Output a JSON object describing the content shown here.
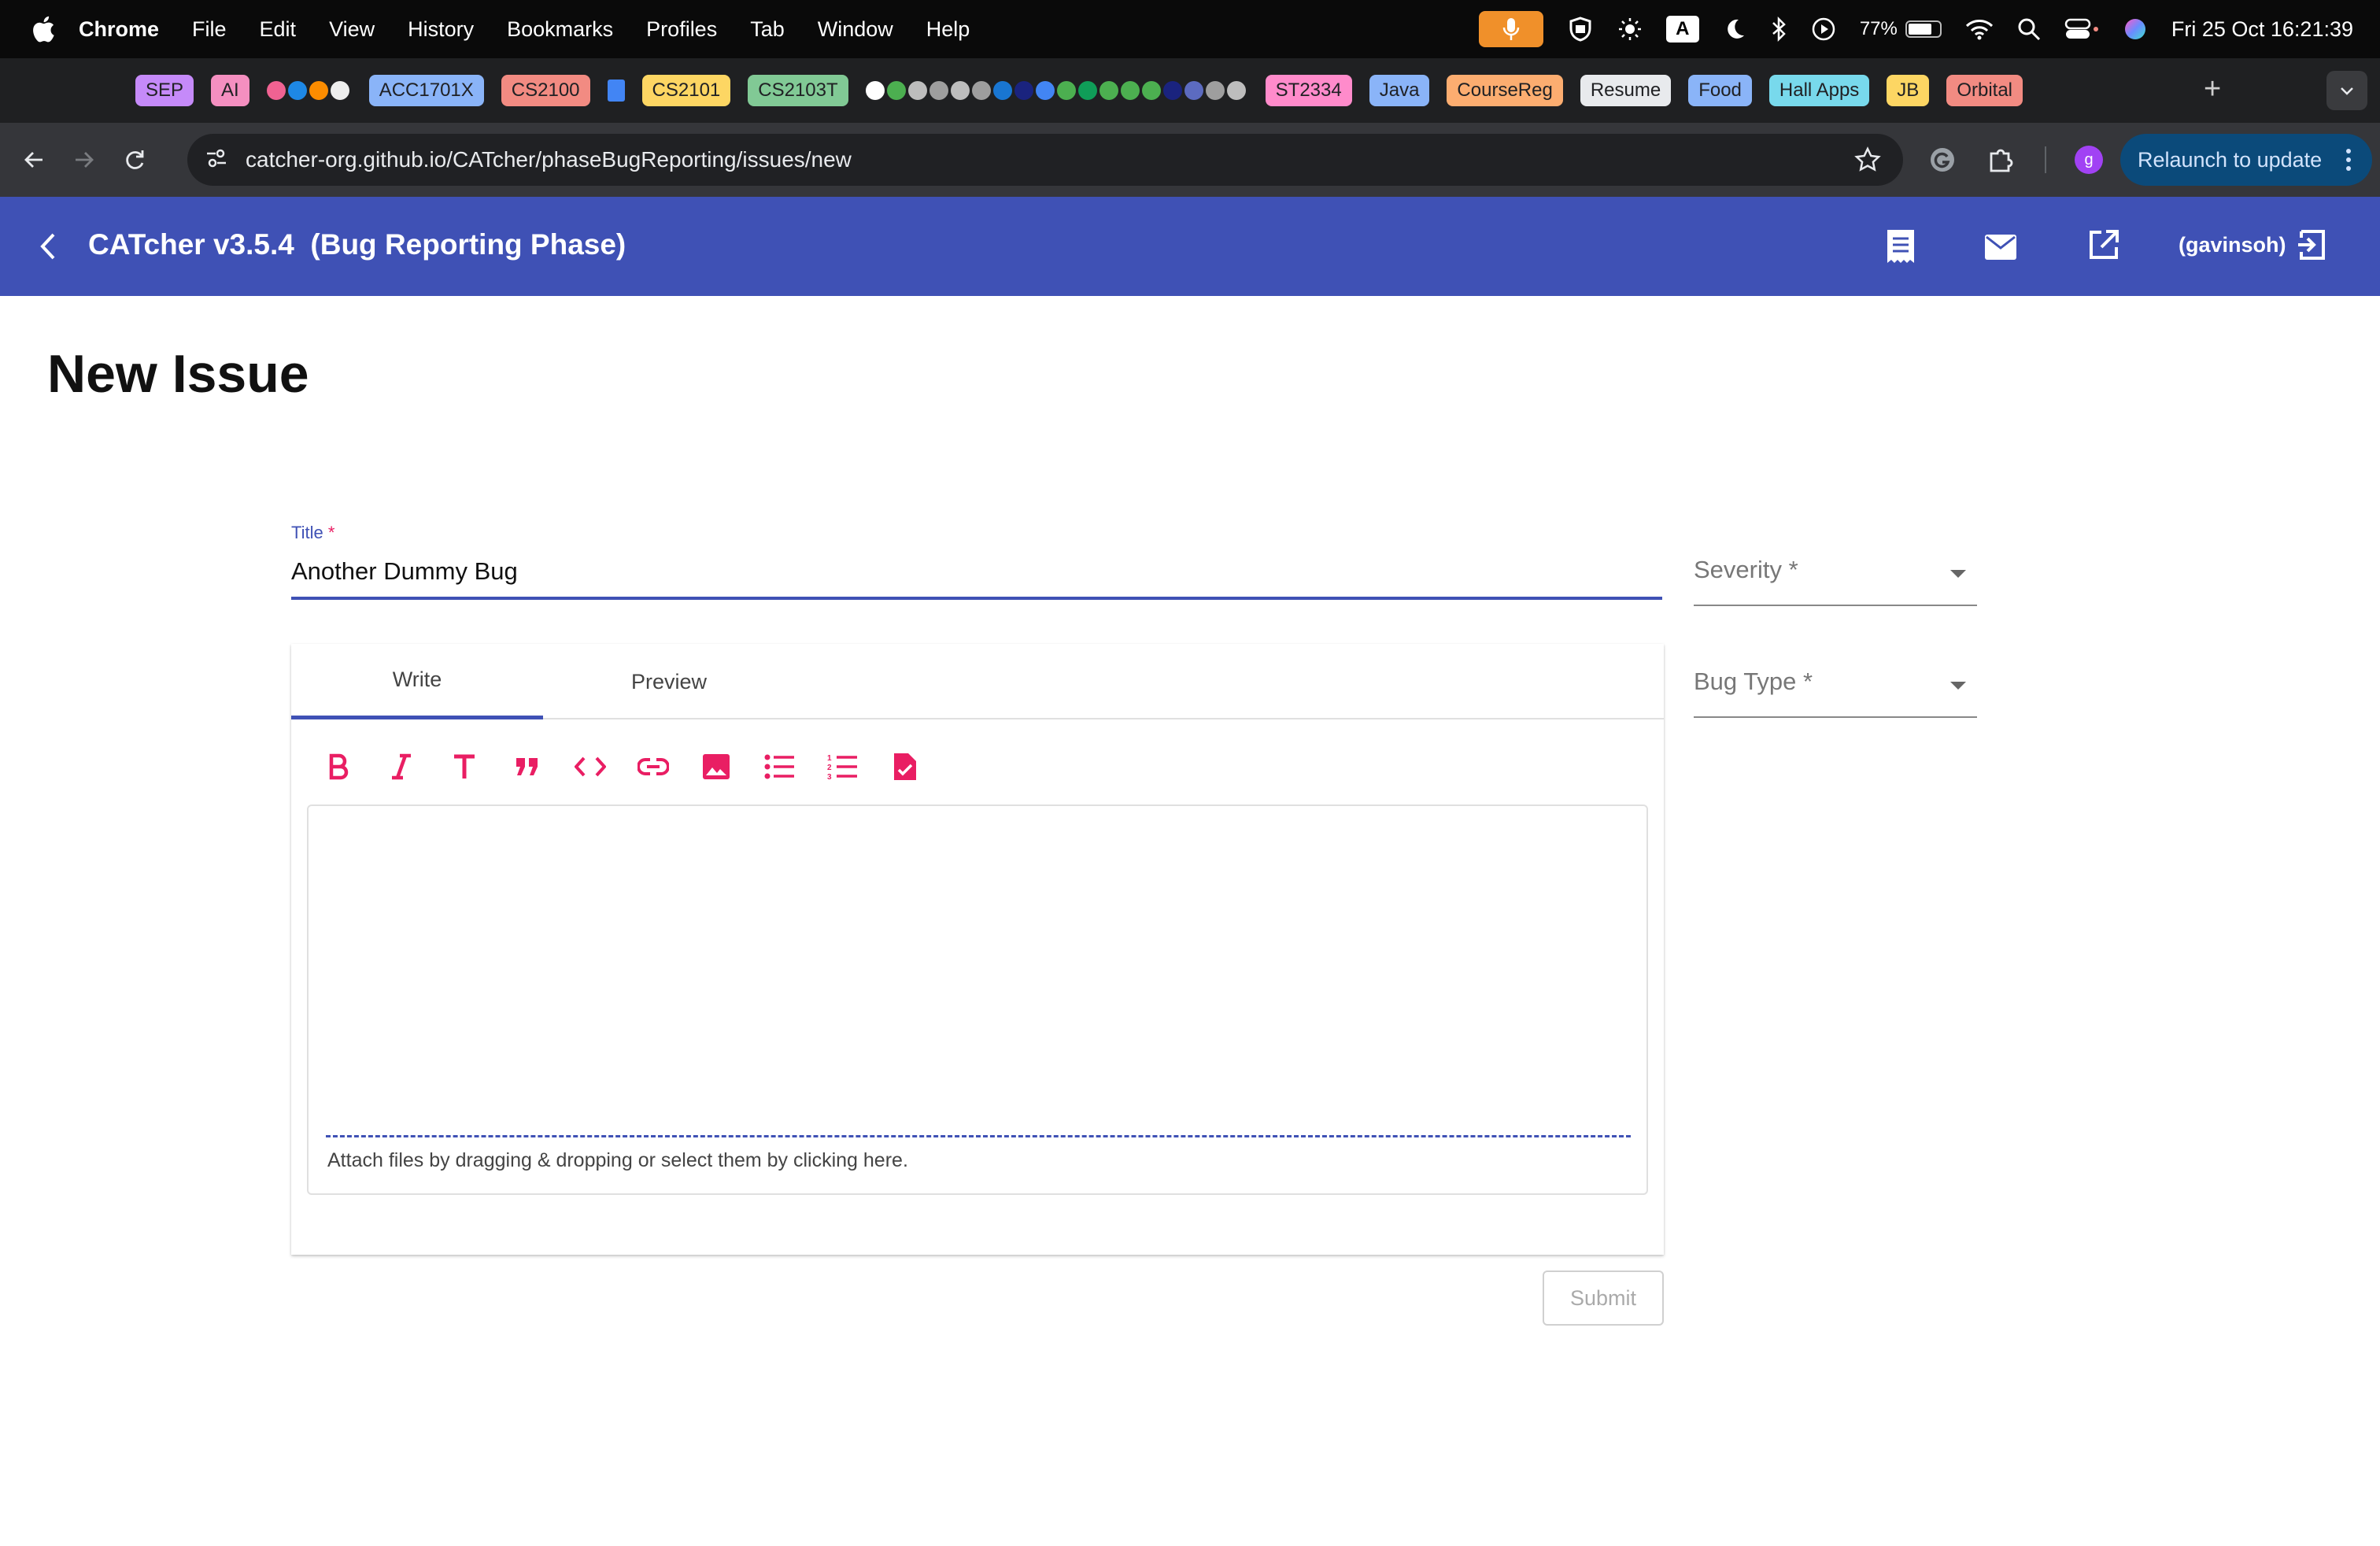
{
  "menubar": {
    "app": "Chrome",
    "items": [
      "File",
      "Edit",
      "View",
      "History",
      "Bookmarks",
      "Profiles",
      "Tab",
      "Window",
      "Help"
    ],
    "battery": "77%",
    "a_box": "A",
    "datetime": "Fri 25 Oct  16:21:39"
  },
  "bookmarks": {
    "chips": [
      {
        "label": "SEP",
        "color": "#c58af9"
      },
      {
        "label": "AI",
        "color": "#f48fc0"
      },
      {
        "label": "ACC1701X",
        "color": "#8ab4f8"
      },
      {
        "label": "CS2100",
        "color": "#f28b82"
      },
      {
        "label": "CS2101",
        "color": "#fdd663"
      },
      {
        "label": "CS2103T",
        "color": "#81c995"
      },
      {
        "label": "ST2334",
        "color": "#ff8bcb"
      },
      {
        "label": "Java",
        "color": "#8ab4f8"
      },
      {
        "label": "CourseReg",
        "color": "#fcad70"
      },
      {
        "label": "Resume",
        "color": "#e8eaed"
      },
      {
        "label": "Food",
        "color": "#8ab4f8"
      },
      {
        "label": "Hall Apps",
        "color": "#78d9ec"
      },
      {
        "label": "JB",
        "color": "#fdd663"
      },
      {
        "label": "Orbital",
        "color": "#f28b82"
      }
    ],
    "new_tab": "+"
  },
  "addressbar": {
    "url": "catcher-org.github.io/CATcher/phaseBugReporting/issues/new",
    "profile_initial": "g",
    "relaunch_label": "Relaunch to update"
  },
  "app": {
    "title": "CATcher v3.5.4  (Bug Reporting Phase)",
    "user": "(gavinsoh)",
    "brand_color": "#3f51b5",
    "accent_color": "#e91e63"
  },
  "page": {
    "heading": "New Issue"
  },
  "form": {
    "title_label": "Title",
    "required_marker": "*",
    "title_value": "Another Dummy Bug",
    "severity_label": "Severity *",
    "bug_type_label": "Bug Type *",
    "tabs": [
      "Write",
      "Preview"
    ],
    "active_tab": "Write",
    "toolbar_icons": [
      "bold-icon",
      "italic-icon",
      "heading-icon",
      "quote-icon",
      "code-icon",
      "link-icon",
      "image-icon",
      "bulleted-list-icon",
      "numbered-list-icon",
      "task-list-icon"
    ],
    "attach_hint": "Attach files by dragging & dropping or select them by clicking here.",
    "submit_label": "Submit"
  }
}
